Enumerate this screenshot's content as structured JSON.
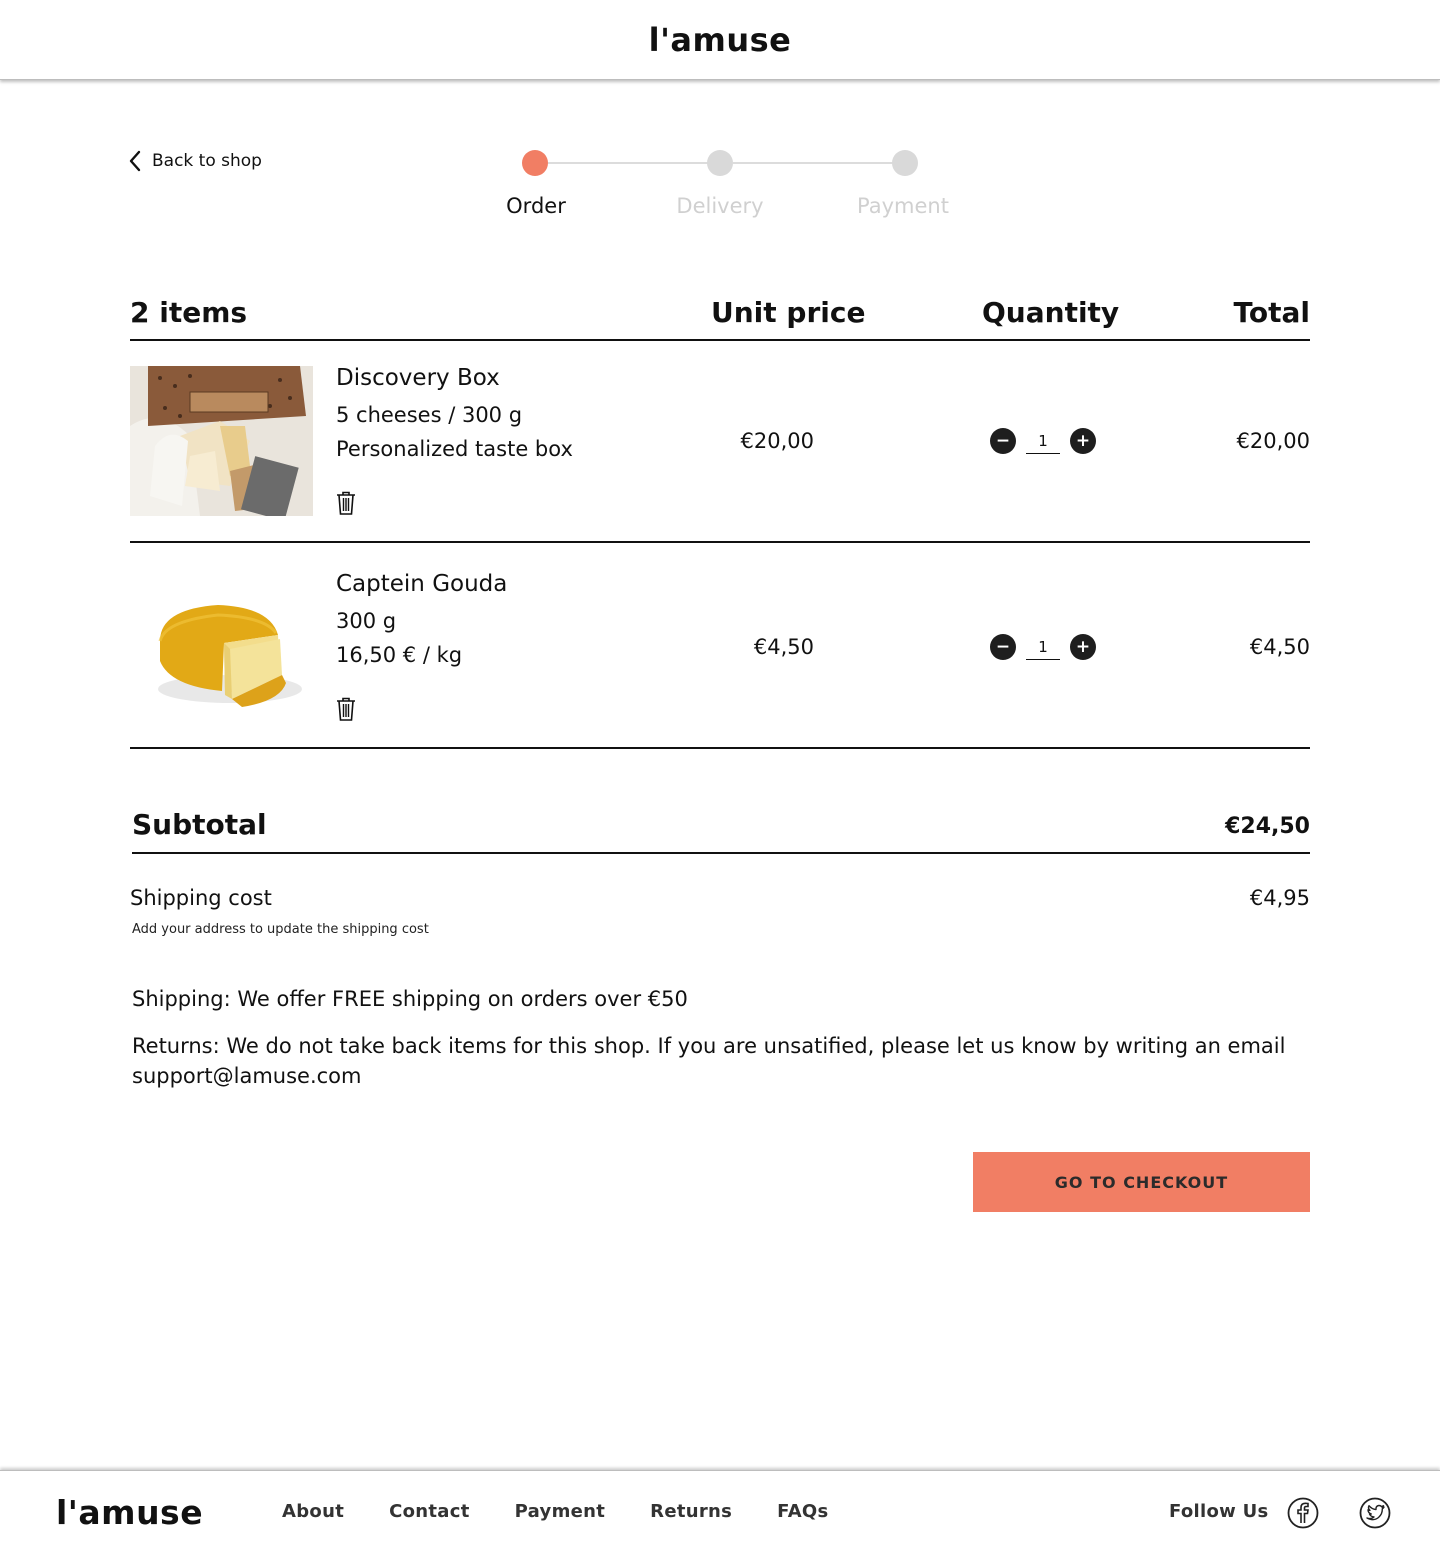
{
  "brand": {
    "name": "l'amuse"
  },
  "nav": {
    "back_label": "Back to shop"
  },
  "stepper": {
    "steps": [
      {
        "label": "Order",
        "active": true
      },
      {
        "label": "Delivery",
        "active": false
      },
      {
        "label": "Payment",
        "active": false
      }
    ],
    "active_color": "#f17e64",
    "inactive_color": "#d9d9d9"
  },
  "cart": {
    "headers": {
      "items": "2 items",
      "unit_price": "Unit price",
      "quantity": "Quantity",
      "total": "Total"
    },
    "items": [
      {
        "name": "Discovery Box",
        "detail1": "5 cheeses / 300 g",
        "detail2": "Personalized taste box",
        "unit_price": "€20,00",
        "quantity": "1",
        "total": "€20,00",
        "image": "cheese-box-photo"
      },
      {
        "name": "Captein Gouda",
        "detail1": "300 g",
        "detail2": "16,50 € / kg",
        "unit_price": "€4,50",
        "quantity": "1",
        "total": "€4,50",
        "image": "gouda-wheel-photo"
      }
    ]
  },
  "summary": {
    "subtotal_label": "Subtotal",
    "subtotal_value": "€24,50",
    "shipping_label": "Shipping cost",
    "shipping_value": "€4,95",
    "shipping_note": "Add your address to update the shipping cost",
    "shipping_policy": "Shipping: We offer FREE shipping on orders over €50",
    "returns_policy_line1": "Returns: We do not take back items for this shop. If you are unsatified, please let us know by writing an email",
    "returns_policy_line2": "support@lamuse.com"
  },
  "checkout": {
    "label": "GO TO CHECKOUT",
    "color": "#f17e64"
  },
  "footer": {
    "logo": "l'amuse",
    "links": [
      "About",
      "Contact",
      "Payment",
      "Returns",
      "FAQs"
    ],
    "follow_label": "Follow Us",
    "social": [
      "facebook-icon",
      "twitter-icon"
    ]
  }
}
